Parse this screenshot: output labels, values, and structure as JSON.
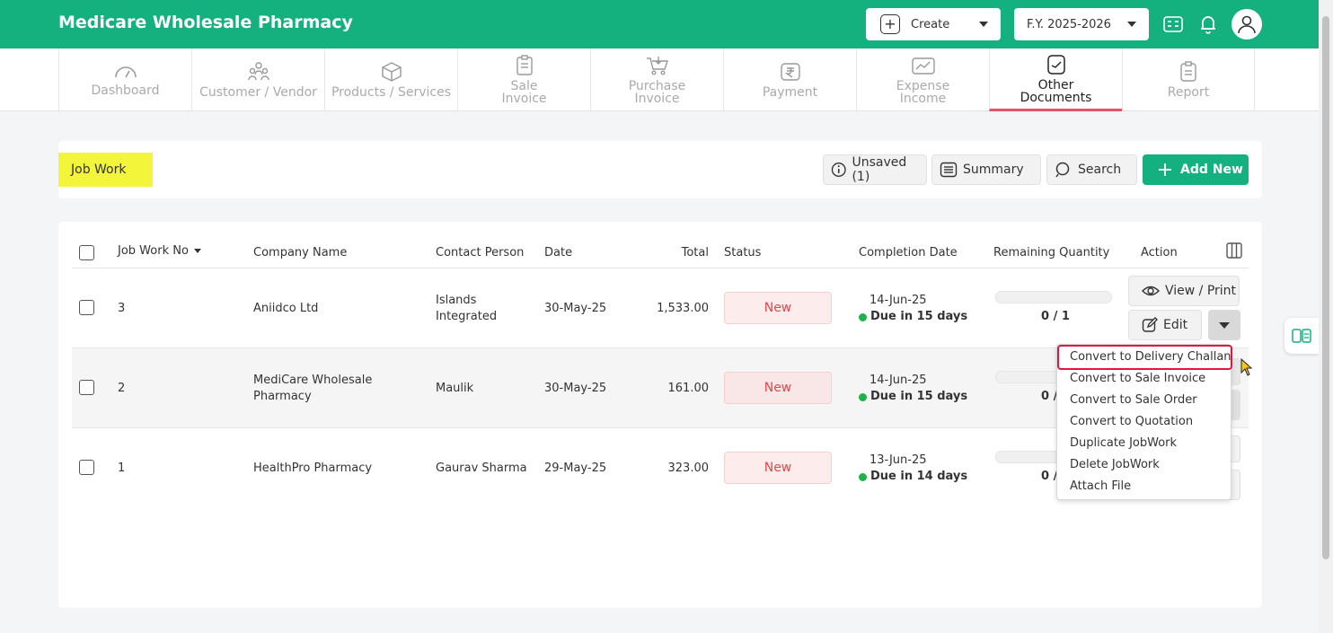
{
  "app": {
    "title": "Medicare Wholesale Pharmacy",
    "create_label": "Create",
    "fy_label": "F.Y. 2025-2026"
  },
  "nav": [
    {
      "label": "Dashboard",
      "icon": "gauge-icon"
    },
    {
      "label": "Customer / Vendor",
      "icon": "users-icon"
    },
    {
      "label": "Products / Services",
      "icon": "box-icon"
    },
    {
      "label": "Sale\nInvoice",
      "icon": "invoice-icon"
    },
    {
      "label": "Purchase\nInvoice",
      "icon": "cart-icon"
    },
    {
      "label": "Payment",
      "icon": "rupee-icon"
    },
    {
      "label": "Expense\nIncome",
      "icon": "wallet-icon"
    },
    {
      "label": "Other\nDocuments",
      "icon": "document-icon",
      "active": true
    },
    {
      "label": "Report",
      "icon": "report-icon"
    }
  ],
  "header": {
    "page_title": "Job Work",
    "unsaved_label": "Unsaved (1)",
    "summary_label": "Summary",
    "search_label": "Search",
    "add_new_label": "Add New"
  },
  "table": {
    "columns": {
      "job_no": "Job Work No",
      "company": "Company Name",
      "contact": "Contact Person",
      "date": "Date",
      "total": "Total",
      "status": "Status",
      "completion": "Completion Date",
      "remaining": "Remaining Quantity",
      "action": "Action"
    },
    "rows": [
      {
        "job_no": "3",
        "company_l1": "Aniidco Ltd",
        "company_l2": "",
        "contact_l1": "Islands",
        "contact_l2": "Integrated",
        "date": "30-May-25",
        "total": "1,533.00",
        "status": "New",
        "completion_date": "14-Jun-25",
        "due": "Due in 15 days",
        "remaining": "0 / 1",
        "progress": 0
      },
      {
        "job_no": "2",
        "company_l1": "MediCare Wholesale",
        "company_l2": "Pharmacy",
        "contact_l1": "Maulik",
        "contact_l2": "",
        "date": "30-May-25",
        "total": "161.00",
        "status": "New",
        "completion_date": "14-Jun-25",
        "due": "Due in 15 days",
        "remaining": "0 /",
        "progress": 0
      },
      {
        "job_no": "1",
        "company_l1": "HealthPro Pharmacy",
        "company_l2": "",
        "contact_l1": "Gaurav Sharma",
        "contact_l2": "",
        "date": "29-May-25",
        "total": "323.00",
        "status": "New",
        "completion_date": "13-Jun-25",
        "due": "Due in 14 days",
        "remaining": "0 /",
        "progress": 0
      }
    ],
    "view_print_label": "View / Print",
    "edit_label": "Edit"
  },
  "menu": {
    "items": [
      "Convert to Delivery Challan",
      "Convert to Sale Invoice",
      "Convert to Sale Order",
      "Convert to Quotation",
      "Duplicate JobWork",
      "Delete JobWork",
      "Attach File"
    ]
  },
  "colors": {
    "brand": "#14b17e",
    "status_new_text": "#e04a4a",
    "status_new_bg": "#fdecec",
    "highlight": "#e0163e",
    "title_highlight": "#f3f53a"
  }
}
